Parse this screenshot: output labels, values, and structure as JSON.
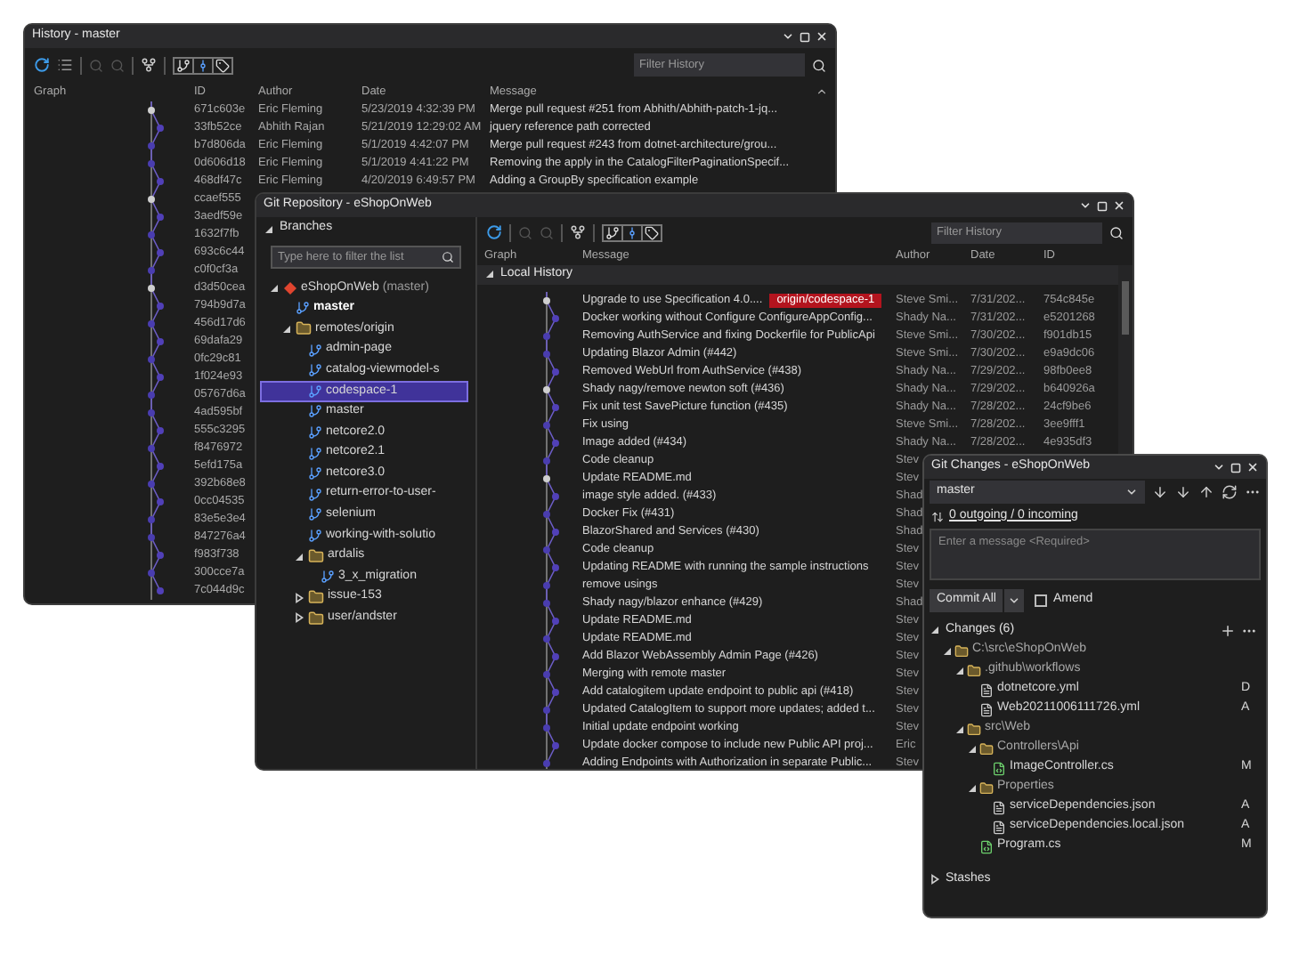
{
  "history_window": {
    "title": "History - master",
    "filter_placeholder": "Filter History",
    "columns": [
      "Graph",
      "ID",
      "Author",
      "Date",
      "Message"
    ],
    "rows": [
      {
        "id": "671c603e",
        "author": "Eric Fleming",
        "date": "5/23/2019 4:32:39 PM",
        "message": "Merge pull request #251 from Abhith/Abhith-patch-1-jq..."
      },
      {
        "id": "33fb52ce",
        "author": "Abhith Rajan",
        "date": "5/21/2019 12:29:02 AM",
        "message": "jquery reference path corrected"
      },
      {
        "id": "b7d806da",
        "author": "Eric Fleming",
        "date": "5/1/2019 4:42:07 PM",
        "message": "Merge pull request #243 from dotnet-architecture/grou..."
      },
      {
        "id": "0d606d18",
        "author": "Eric Fleming",
        "date": "5/1/2019 4:41:22 PM",
        "message": "Removing the apply in the CatalogFilterPaginationSpecif..."
      },
      {
        "id": "468df47c",
        "author": "Eric Fleming",
        "date": "4/20/2019 6:49:57 PM",
        "message": "Adding a GroupBy specification example"
      },
      {
        "id": "ccaef555"
      },
      {
        "id": "3aedf59e"
      },
      {
        "id": "1632f7fb"
      },
      {
        "id": "693c6c44"
      },
      {
        "id": "c0f0cf3a"
      },
      {
        "id": "d3d50cea"
      },
      {
        "id": "794b9d7a"
      },
      {
        "id": "456d17d6"
      },
      {
        "id": "69dafa29"
      },
      {
        "id": "0fc29c81"
      },
      {
        "id": "1f024e93"
      },
      {
        "id": "05767d6a"
      },
      {
        "id": "4ad595bf"
      },
      {
        "id": "555c3295"
      },
      {
        "id": "f8476972"
      },
      {
        "id": "5efd175a"
      },
      {
        "id": "392b68e8"
      },
      {
        "id": "0cc04535"
      },
      {
        "id": "83e5e3e4"
      },
      {
        "id": "847276a4"
      },
      {
        "id": "f983f738"
      },
      {
        "id": "300cce7a"
      },
      {
        "id": "7c044d9c"
      }
    ]
  },
  "repo_window": {
    "title": "Git Repository - eShopOnWeb",
    "branches_title": "Branches",
    "branch_filter_placeholder": "Type here to filter the list",
    "branches": [
      {
        "kind": "repo",
        "label": "eShopOnWeb",
        "suffix": "(master)",
        "expanded": true,
        "selected": false,
        "children": [
          {
            "kind": "branch",
            "label": "master",
            "current": true,
            "selected": false
          },
          {
            "kind": "folder",
            "label": "remotes/origin",
            "expanded": true,
            "selected": false,
            "children": [
              {
                "kind": "branch",
                "label": "admin-page",
                "current": false,
                "selected": false
              },
              {
                "kind": "branch",
                "label": "catalog-viewmodel-s",
                "current": false,
                "selected": false
              },
              {
                "kind": "branch",
                "label": "codespace-1",
                "current": false,
                "selected": true
              },
              {
                "kind": "branch",
                "label": "master",
                "current": false,
                "selected": false
              },
              {
                "kind": "branch",
                "label": "netcore2.0",
                "current": false,
                "selected": false
              },
              {
                "kind": "branch",
                "label": "netcore2.1",
                "current": false,
                "selected": false
              },
              {
                "kind": "branch",
                "label": "netcore3.0",
                "current": false,
                "selected": false
              },
              {
                "kind": "branch",
                "label": "return-error-to-user-",
                "current": false,
                "selected": false
              },
              {
                "kind": "branch",
                "label": "selenium",
                "current": false,
                "selected": false
              },
              {
                "kind": "branch",
                "label": "working-with-solutio",
                "current": false,
                "selected": false
              },
              {
                "kind": "folder",
                "label": "ardalis",
                "expanded": true,
                "selected": false,
                "children": [
                  {
                    "kind": "branch",
                    "label": "3_x_migration",
                    "current": false,
                    "selected": false
                  }
                ]
              },
              {
                "kind": "folder",
                "label": "issue-153",
                "expanded": false,
                "selected": false
              },
              {
                "kind": "folder",
                "label": "user/andster",
                "expanded": false,
                "selected": false
              }
            ]
          }
        ]
      }
    ],
    "filter_placeholder": "Filter History",
    "columns": [
      "Graph",
      "Message",
      "Author",
      "Date",
      "ID"
    ],
    "section": "Local History",
    "rows": [
      {
        "message": "Upgrade to use Specification 4.0....",
        "tag": "origin/codespace-1",
        "author": "Steve Smi...",
        "date": "7/31/202...",
        "id": "754c845e"
      },
      {
        "message": "Docker working without Configure ConfigureAppConfig...",
        "author": "Shady Na...",
        "date": "7/31/202...",
        "id": "e5201268"
      },
      {
        "message": "Removing AuthService and fixing Dockerfile for PublicApi",
        "author": "Steve Smi...",
        "date": "7/30/202...",
        "id": "f901db15"
      },
      {
        "message": "Updating Blazor Admin (#442)",
        "author": "Steve Smi...",
        "date": "7/30/202...",
        "id": "e9a9dc06"
      },
      {
        "message": "Removed WebUrl from AuthService (#438)",
        "author": "Shady Na...",
        "date": "7/29/202...",
        "id": "98fb0ee8"
      },
      {
        "message": "Shady nagy/remove newton soft (#436)",
        "author": "Shady Na...",
        "date": "7/29/202...",
        "id": "b640926a"
      },
      {
        "message": "Fix unit test SavePicture function (#435)",
        "author": "Shady Na...",
        "date": "7/28/202...",
        "id": "24cf9be6"
      },
      {
        "message": "Fix using",
        "author": "Steve Smi...",
        "date": "7/28/202...",
        "id": "3ee9fff1"
      },
      {
        "message": "Image added (#434)",
        "author": "Shady Na...",
        "date": "7/28/202...",
        "id": "4e935df3"
      },
      {
        "message": "Code cleanup",
        "author": "Stev"
      },
      {
        "message": "Update README.md",
        "author": "Stev"
      },
      {
        "message": "image style added. (#433)",
        "author": "Shad"
      },
      {
        "message": "Docker Fix (#431)",
        "author": "Shad"
      },
      {
        "message": "BlazorShared and Services (#430)",
        "author": "Shad"
      },
      {
        "message": "Code cleanup",
        "author": "Stev"
      },
      {
        "message": "Updating README with running the sample instructions",
        "author": "Stev"
      },
      {
        "message": "remove usings",
        "author": "Stev"
      },
      {
        "message": "Shady nagy/blazor enhance (#429)",
        "author": "Shad"
      },
      {
        "message": "Update README.md",
        "author": "Stev"
      },
      {
        "message": "Update README.md",
        "author": "Stev"
      },
      {
        "message": "Add Blazor WebAssembly Admin Page (#426)",
        "author": "Stev"
      },
      {
        "message": "Merging with remote master",
        "author": "Stev"
      },
      {
        "message": "Add catalogitem update endpoint to public api (#418)",
        "author": "Stev"
      },
      {
        "message": "Updated CatalogItem to support more updates; added t...",
        "author": "Stev"
      },
      {
        "message": "Initial update endpoint working",
        "author": "Stev"
      },
      {
        "message": "Update docker compose to include new Public API proj...",
        "author": "Eric"
      },
      {
        "message": "Adding Endpoints with Authorization in separate Public...",
        "author": "Stev"
      }
    ]
  },
  "changes_window": {
    "title": "Git Changes - eShopOnWeb",
    "branch": "master",
    "sync_status": "0 outgoing / 0 incoming",
    "message_placeholder": "Enter a message <Required>",
    "commit_button": "Commit All",
    "amend": {
      "label": "Amend",
      "checked": false
    },
    "changes_title": "Changes (6)",
    "changes_expanded": true,
    "tree": [
      {
        "kind": "folder",
        "label": "C:\\src\\eShopOnWeb",
        "expanded": true,
        "children": [
          {
            "kind": "folder",
            "label": ".github\\workflows",
            "expanded": true,
            "children": [
              {
                "kind": "yml",
                "label": "dotnetcore.yml",
                "status": "D"
              },
              {
                "kind": "yml",
                "label": "Web20211006111726.yml",
                "status": "A"
              }
            ]
          },
          {
            "kind": "folder",
            "label": "src\\Web",
            "expanded": true,
            "children": [
              {
                "kind": "folder",
                "label": "Controllers\\Api",
                "expanded": true,
                "children": [
                  {
                    "kind": "cs",
                    "label": "ImageController.cs",
                    "status": "M"
                  }
                ]
              },
              {
                "kind": "folder",
                "label": "Properties",
                "expanded": true,
                "children": [
                  {
                    "kind": "json",
                    "label": "serviceDependencies.json",
                    "status": "A"
                  },
                  {
                    "kind": "json",
                    "label": "serviceDependencies.local.json",
                    "status": "A"
                  }
                ]
              },
              {
                "kind": "cs",
                "label": "Program.cs",
                "status": "M"
              }
            ]
          }
        ]
      }
    ],
    "stashes": {
      "label": "Stashes",
      "expanded": false
    }
  }
}
